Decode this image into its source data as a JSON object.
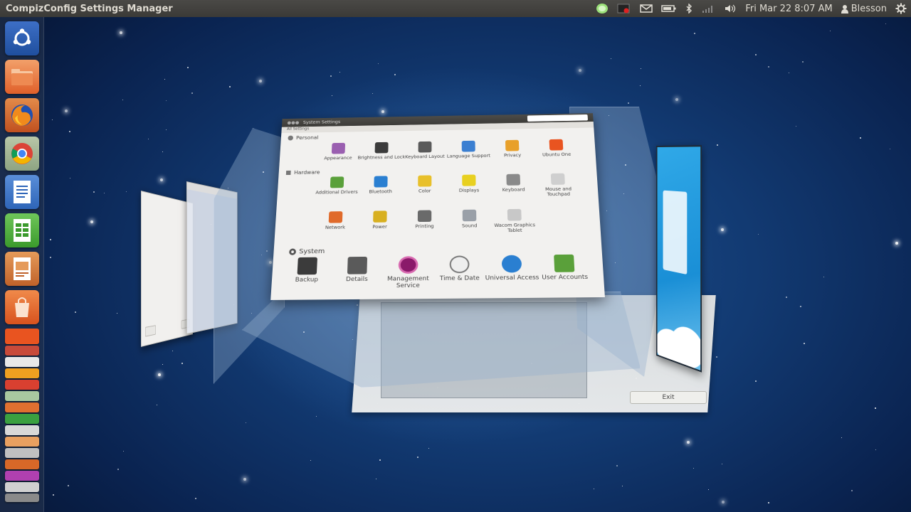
{
  "top_panel": {
    "app_title": "CompizConfig Settings Manager",
    "datetime": "Fri Mar 22  8:07 AM",
    "user": "Blesson"
  },
  "colors": {
    "panel": "#3c3b37",
    "launcher_bg": "#2b3a52",
    "desktop": "#123a72",
    "ubuntu_orange": "#e95420"
  },
  "launcher": {
    "items": [
      {
        "name": "dash-home",
        "icon": "ubuntu-logo-icon"
      },
      {
        "name": "files",
        "icon": "folder-icon"
      },
      {
        "name": "firefox",
        "icon": "firefox-icon"
      },
      {
        "name": "chrome",
        "icon": "chrome-icon"
      },
      {
        "name": "writer",
        "icon": "writer-document-icon"
      },
      {
        "name": "calc",
        "icon": "calc-spreadsheet-icon"
      },
      {
        "name": "impress",
        "icon": "impress-presentation-icon"
      },
      {
        "name": "software-center",
        "icon": "shopping-bag-icon"
      }
    ]
  },
  "settings_window": {
    "title": "System Settings",
    "toolbar": "All Settings",
    "sections": {
      "personal": "Personal",
      "hardware": "Hardware",
      "system": "System"
    },
    "personal_items": [
      "Appearance",
      "Brightness and Lock",
      "Keyboard Layout",
      "Language Support",
      "Privacy",
      "Ubuntu One"
    ],
    "hardware_row1": [
      "Additional Drivers",
      "Bluetooth",
      "Color",
      "Displays",
      "Keyboard",
      "Mouse and Touchpad"
    ],
    "hardware_row2": [
      "Network",
      "Power",
      "Printing",
      "Sound",
      "Wacom Graphics Tablet"
    ],
    "system_items": [
      "Backup",
      "Details",
      "Management Service",
      "Time & Date",
      "Universal Access",
      "User Accounts"
    ]
  },
  "back_window": {
    "exit_label": "Exit"
  }
}
